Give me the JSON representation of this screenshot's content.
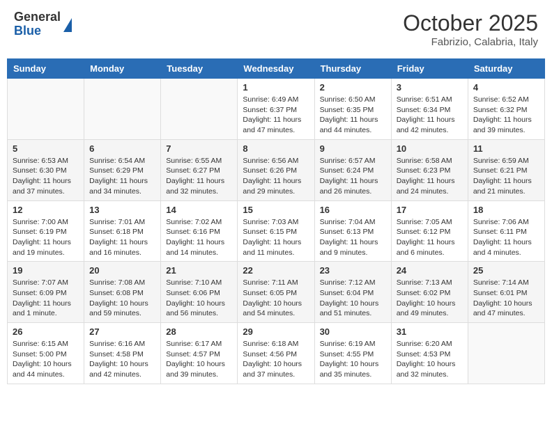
{
  "header": {
    "logo": {
      "general": "General",
      "blue": "Blue"
    },
    "title": "October 2025",
    "subtitle": "Fabrizio, Calabria, Italy"
  },
  "days_of_week": [
    "Sunday",
    "Monday",
    "Tuesday",
    "Wednesday",
    "Thursday",
    "Friday",
    "Saturday"
  ],
  "weeks": [
    [
      {
        "day": "",
        "info": ""
      },
      {
        "day": "",
        "info": ""
      },
      {
        "day": "",
        "info": ""
      },
      {
        "day": "1",
        "info": "Sunrise: 6:49 AM\nSunset: 6:37 PM\nDaylight: 11 hours and 47 minutes."
      },
      {
        "day": "2",
        "info": "Sunrise: 6:50 AM\nSunset: 6:35 PM\nDaylight: 11 hours and 44 minutes."
      },
      {
        "day": "3",
        "info": "Sunrise: 6:51 AM\nSunset: 6:34 PM\nDaylight: 11 hours and 42 minutes."
      },
      {
        "day": "4",
        "info": "Sunrise: 6:52 AM\nSunset: 6:32 PM\nDaylight: 11 hours and 39 minutes."
      }
    ],
    [
      {
        "day": "5",
        "info": "Sunrise: 6:53 AM\nSunset: 6:30 PM\nDaylight: 11 hours and 37 minutes."
      },
      {
        "day": "6",
        "info": "Sunrise: 6:54 AM\nSunset: 6:29 PM\nDaylight: 11 hours and 34 minutes."
      },
      {
        "day": "7",
        "info": "Sunrise: 6:55 AM\nSunset: 6:27 PM\nDaylight: 11 hours and 32 minutes."
      },
      {
        "day": "8",
        "info": "Sunrise: 6:56 AM\nSunset: 6:26 PM\nDaylight: 11 hours and 29 minutes."
      },
      {
        "day": "9",
        "info": "Sunrise: 6:57 AM\nSunset: 6:24 PM\nDaylight: 11 hours and 26 minutes."
      },
      {
        "day": "10",
        "info": "Sunrise: 6:58 AM\nSunset: 6:23 PM\nDaylight: 11 hours and 24 minutes."
      },
      {
        "day": "11",
        "info": "Sunrise: 6:59 AM\nSunset: 6:21 PM\nDaylight: 11 hours and 21 minutes."
      }
    ],
    [
      {
        "day": "12",
        "info": "Sunrise: 7:00 AM\nSunset: 6:19 PM\nDaylight: 11 hours and 19 minutes."
      },
      {
        "day": "13",
        "info": "Sunrise: 7:01 AM\nSunset: 6:18 PM\nDaylight: 11 hours and 16 minutes."
      },
      {
        "day": "14",
        "info": "Sunrise: 7:02 AM\nSunset: 6:16 PM\nDaylight: 11 hours and 14 minutes."
      },
      {
        "day": "15",
        "info": "Sunrise: 7:03 AM\nSunset: 6:15 PM\nDaylight: 11 hours and 11 minutes."
      },
      {
        "day": "16",
        "info": "Sunrise: 7:04 AM\nSunset: 6:13 PM\nDaylight: 11 hours and 9 minutes."
      },
      {
        "day": "17",
        "info": "Sunrise: 7:05 AM\nSunset: 6:12 PM\nDaylight: 11 hours and 6 minutes."
      },
      {
        "day": "18",
        "info": "Sunrise: 7:06 AM\nSunset: 6:11 PM\nDaylight: 11 hours and 4 minutes."
      }
    ],
    [
      {
        "day": "19",
        "info": "Sunrise: 7:07 AM\nSunset: 6:09 PM\nDaylight: 11 hours and 1 minute."
      },
      {
        "day": "20",
        "info": "Sunrise: 7:08 AM\nSunset: 6:08 PM\nDaylight: 10 hours and 59 minutes."
      },
      {
        "day": "21",
        "info": "Sunrise: 7:10 AM\nSunset: 6:06 PM\nDaylight: 10 hours and 56 minutes."
      },
      {
        "day": "22",
        "info": "Sunrise: 7:11 AM\nSunset: 6:05 PM\nDaylight: 10 hours and 54 minutes."
      },
      {
        "day": "23",
        "info": "Sunrise: 7:12 AM\nSunset: 6:04 PM\nDaylight: 10 hours and 51 minutes."
      },
      {
        "day": "24",
        "info": "Sunrise: 7:13 AM\nSunset: 6:02 PM\nDaylight: 10 hours and 49 minutes."
      },
      {
        "day": "25",
        "info": "Sunrise: 7:14 AM\nSunset: 6:01 PM\nDaylight: 10 hours and 47 minutes."
      }
    ],
    [
      {
        "day": "26",
        "info": "Sunrise: 6:15 AM\nSunset: 5:00 PM\nDaylight: 10 hours and 44 minutes."
      },
      {
        "day": "27",
        "info": "Sunrise: 6:16 AM\nSunset: 4:58 PM\nDaylight: 10 hours and 42 minutes."
      },
      {
        "day": "28",
        "info": "Sunrise: 6:17 AM\nSunset: 4:57 PM\nDaylight: 10 hours and 39 minutes."
      },
      {
        "day": "29",
        "info": "Sunrise: 6:18 AM\nSunset: 4:56 PM\nDaylight: 10 hours and 37 minutes."
      },
      {
        "day": "30",
        "info": "Sunrise: 6:19 AM\nSunset: 4:55 PM\nDaylight: 10 hours and 35 minutes."
      },
      {
        "day": "31",
        "info": "Sunrise: 6:20 AM\nSunset: 4:53 PM\nDaylight: 10 hours and 32 minutes."
      },
      {
        "day": "",
        "info": ""
      }
    ]
  ]
}
